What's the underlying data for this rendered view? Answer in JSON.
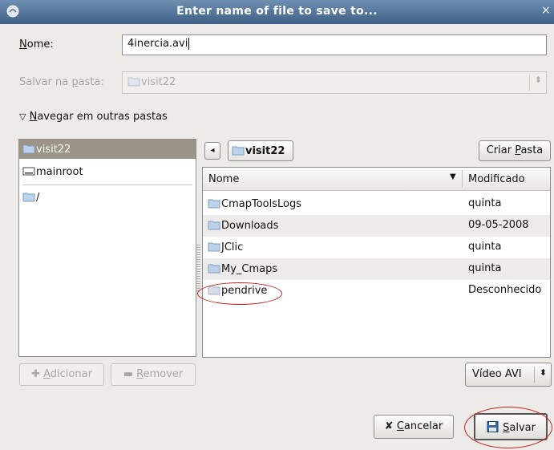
{
  "window": {
    "title": "Enter name of file to save to..."
  },
  "name_row": {
    "label_first": "N",
    "label_rest": "ome:",
    "value": "4inercia.avi"
  },
  "folder_row": {
    "label_pre": "Salvar na ",
    "label_u": "p",
    "label_post": "asta:",
    "value": "visit22"
  },
  "expander": {
    "label_first": "N",
    "label_rest": "avegar em outras pastas"
  },
  "places": [
    {
      "label": "visit22",
      "icon": "folder-icon",
      "selected": true
    },
    {
      "label": "mainroot",
      "icon": "drive-icon",
      "selected": false
    },
    {
      "label": "/",
      "icon": "folder-icon",
      "selected": false
    }
  ],
  "pathbar": {
    "current": "visit22"
  },
  "create_folder": {
    "label_pre": "Criar ",
    "label_u": "P",
    "label_post": "asta"
  },
  "columns": {
    "name": "Nome",
    "modified": "Modificado"
  },
  "files": [
    {
      "name": "CmapToolsLogs",
      "modified": "quinta"
    },
    {
      "name": "Downloads",
      "modified": "09-05-2008"
    },
    {
      "name": "JClic",
      "modified": "quinta"
    },
    {
      "name": "My_Cmaps",
      "modified": "quinta"
    },
    {
      "name": "pendrive",
      "modified": "Desconhecido"
    }
  ],
  "add_button": {
    "label_u": "A",
    "label_rest": "dicionar"
  },
  "remove_button": {
    "label_u": "R",
    "label_rest": "emover"
  },
  "filter": {
    "value": "Vídeo AVI"
  },
  "cancel_button": {
    "label_u": "C",
    "label_rest": "ancelar"
  },
  "save_button": {
    "label_u": "S",
    "label_rest": "alvar"
  },
  "colors": {
    "titlebar": "#4f6f94",
    "selection": "#9b9487",
    "annotation": "#cc1f1f",
    "folder": "#8fb1d6"
  }
}
